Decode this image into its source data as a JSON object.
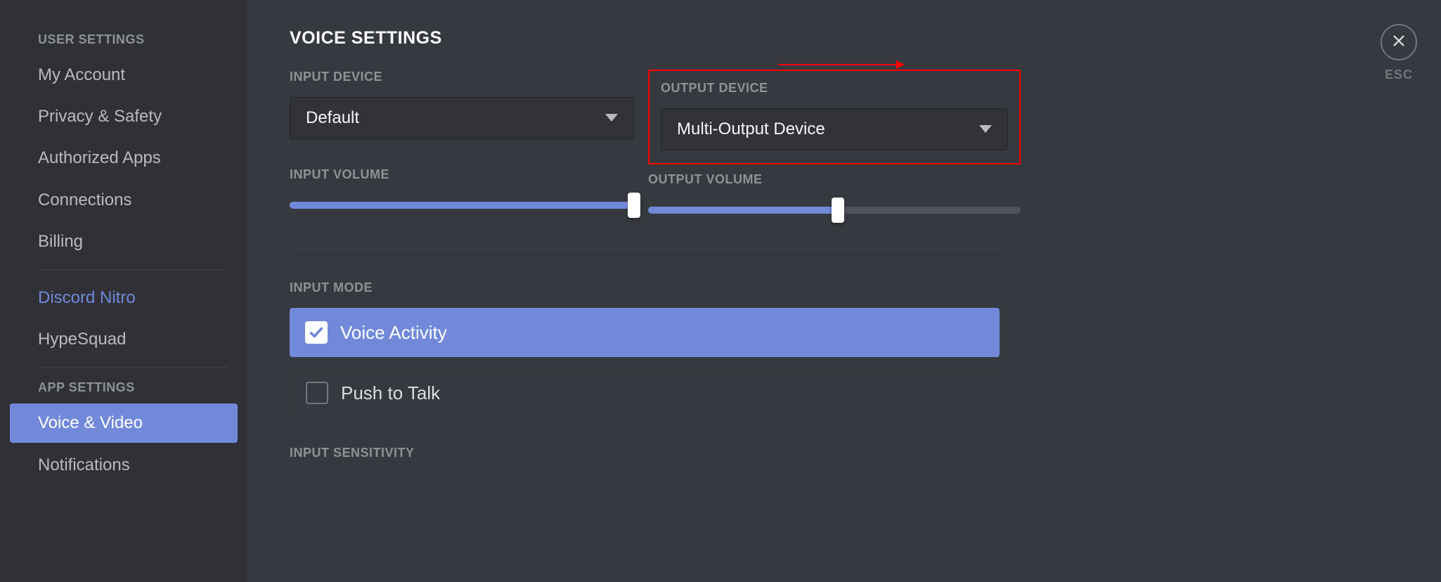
{
  "sidebar": {
    "group1_header": "USER SETTINGS",
    "items1": [
      {
        "label": "My Account"
      },
      {
        "label": "Privacy & Safety"
      },
      {
        "label": "Authorized Apps"
      },
      {
        "label": "Connections"
      },
      {
        "label": "Billing"
      }
    ],
    "nitro_label": "Discord Nitro",
    "hypesquad_label": "HypeSquad",
    "group2_header": "APP SETTINGS",
    "items2": [
      {
        "label": "Voice & Video",
        "active": true
      },
      {
        "label": "Notifications"
      }
    ]
  },
  "page": {
    "title": "VOICE SETTINGS",
    "esc_label": "ESC"
  },
  "input_device": {
    "label": "INPUT DEVICE",
    "value": "Default"
  },
  "output_device": {
    "label": "OUTPUT DEVICE",
    "value": "Multi-Output Device"
  },
  "input_volume": {
    "label": "INPUT VOLUME",
    "percent": 100
  },
  "output_volume": {
    "label": "OUTPUT VOLUME",
    "percent": 51
  },
  "input_mode": {
    "label": "INPUT MODE",
    "option_voice_activity": "Voice Activity",
    "option_ptt": "Push to Talk"
  },
  "input_sensitivity": {
    "label": "INPUT SENSITIVITY"
  }
}
